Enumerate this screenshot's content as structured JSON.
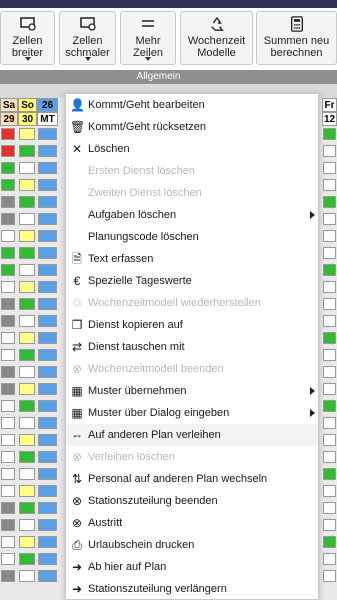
{
  "ribbon": {
    "buttons": [
      {
        "label": "Zellen\nbreiter",
        "icon": "widen-cells-icon",
        "dropdown": true
      },
      {
        "label": "Zellen\nschmaler",
        "icon": "narrow-cells-icon",
        "dropdown": true
      },
      {
        "label": "Mehr\nZeilen",
        "icon": "more-rows-icon",
        "dropdown": true
      },
      {
        "label": "Wochenzeit\nModelle",
        "icon": "recycle-icon",
        "dropdown": false
      },
      {
        "label": "Summen neu\nberechnen",
        "icon": "calculator-icon",
        "dropdown": false
      }
    ],
    "group_label": "Allgemein"
  },
  "grid": {
    "day_headers": [
      "Sa",
      "So",
      "26"
    ],
    "date_row": [
      "29",
      "30",
      "MT"
    ],
    "right_headers": [
      "Fr",
      "12"
    ],
    "colors": {
      "sa": "#ffe0b0",
      "so": "#ffff66",
      "blue": "#5aa0e6",
      "green": "#33bb33",
      "red": "#e53030",
      "yellow": "#ffff88"
    }
  },
  "menu": {
    "items": [
      {
        "label": "Kommt/Geht bearbeiten",
        "icon": "person-clock-icon",
        "enabled": true,
        "submenu": false
      },
      {
        "label": "Kommt/Geht rücksetzen",
        "icon": "trash-icon",
        "enabled": true,
        "submenu": false
      },
      {
        "label": "Löschen",
        "icon": "x-icon",
        "enabled": true,
        "submenu": false
      },
      {
        "label": "Ersten Dienst löschen",
        "icon": "",
        "enabled": false,
        "submenu": false
      },
      {
        "label": "Zweiten Dienst löschen",
        "icon": "",
        "enabled": false,
        "submenu": false
      },
      {
        "label": "Aufgaben löschen",
        "icon": "",
        "enabled": true,
        "submenu": true
      },
      {
        "label": "Planungscode löschen",
        "icon": "",
        "enabled": true,
        "submenu": false
      },
      {
        "label": "Text erfassen",
        "icon": "document-icon",
        "enabled": true,
        "submenu": false
      },
      {
        "label": "Spezielle Tageswerte",
        "icon": "euro-icon",
        "enabled": true,
        "submenu": false
      },
      {
        "label": "Wochenzeitmodell wiederherstellen",
        "icon": "recycle-icon",
        "enabled": false,
        "submenu": false
      },
      {
        "label": "Dienst kopieren auf",
        "icon": "copy-icon",
        "enabled": true,
        "submenu": false
      },
      {
        "label": "Dienst tauschen mit",
        "icon": "swap-icon",
        "enabled": true,
        "submenu": false
      },
      {
        "label": "Wochenzeitmodell beenden",
        "icon": "circle-x-icon",
        "enabled": false,
        "submenu": false
      },
      {
        "label": "Muster übernehmen",
        "icon": "pattern-icon",
        "enabled": true,
        "submenu": true
      },
      {
        "label": "Muster über Dialog eingeben",
        "icon": "pattern-icon",
        "enabled": true,
        "submenu": true
      },
      {
        "label": "Auf anderen Plan verleihen",
        "icon": "double-arrow-icon",
        "enabled": true,
        "submenu": false,
        "highlighted": true
      },
      {
        "label": "Verleihen löschen",
        "icon": "circle-x-icon",
        "enabled": false,
        "submenu": false
      },
      {
        "label": "Personal auf anderen Plan wechseln",
        "icon": "transfer-icon",
        "enabled": true,
        "submenu": false
      },
      {
        "label": "Stationszuteilung beenden",
        "icon": "circle-x-icon",
        "enabled": true,
        "submenu": false
      },
      {
        "label": "Austritt",
        "icon": "circle-x-icon",
        "enabled": true,
        "submenu": false
      },
      {
        "label": "Urlaubschein drucken",
        "icon": "print-icon",
        "enabled": true,
        "submenu": false
      },
      {
        "label": "Ab hier auf Plan",
        "icon": "circle-arrow-icon",
        "enabled": true,
        "submenu": false
      },
      {
        "label": "Stationszuteilung verlängern",
        "icon": "circle-arrow-icon",
        "enabled": true,
        "submenu": false
      }
    ]
  }
}
